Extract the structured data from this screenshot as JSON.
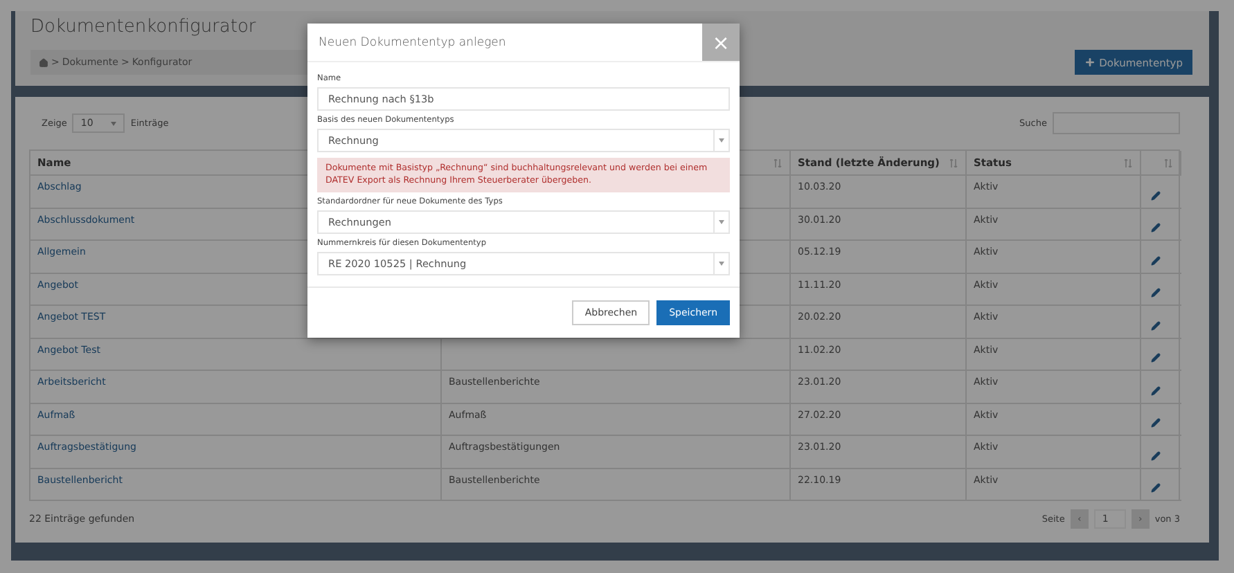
{
  "page": {
    "title": "Dokumentenkonfigurator",
    "breadcrumb": [
      {
        "separator": ">",
        "label": "Dokumente"
      },
      {
        "separator": ">",
        "label": "Konfigurator"
      }
    ],
    "add_button": "Dokumententyp"
  },
  "table_controls": {
    "show_label": "Zeige",
    "page_size": "10",
    "entries_label": "Einträge",
    "search_label": "Suche"
  },
  "table": {
    "columns": [
      {
        "label": "Name"
      },
      {},
      {
        "label": "Stand (letzte Änderung)"
      },
      {
        "label": "Status"
      },
      {}
    ],
    "rows": [
      {
        "name": "Abschlag",
        "date": "10.03.20",
        "status": "Aktiv"
      },
      {
        "name": "Abschlussdokument",
        "date": "30.01.20",
        "status": "Aktiv"
      },
      {
        "name": "Allgemein",
        "date": "05.12.19",
        "status": "Aktiv"
      },
      {
        "name": "Angebot",
        "date": "11.11.20",
        "status": "Aktiv"
      },
      {
        "name": "Angebot TEST",
        "date": "20.02.20",
        "status": "Aktiv"
      },
      {
        "name": "Angebot Test",
        "date": "11.02.20",
        "status": "Aktiv"
      },
      {
        "name": "Arbeitsbericht",
        "folder": "Baustellenberichte",
        "date": "23.01.20",
        "status": "Aktiv"
      },
      {
        "name": "Aufmaß",
        "folder": "Aufmaß",
        "date": "27.02.20",
        "status": "Aktiv"
      },
      {
        "name": "Auftragsbestätigung",
        "folder": "Auftragsbestätigungen",
        "date": "23.01.20",
        "status": "Aktiv"
      },
      {
        "name": "Baustellenbericht",
        "folder": "Baustellenberichte",
        "date": "22.10.19",
        "status": "Aktiv"
      }
    ]
  },
  "table_footer": {
    "count": "22 Einträge gefunden",
    "page_label": "Seite",
    "prev": "‹",
    "page": "1",
    "next": "›",
    "of": "von 3"
  },
  "modal": {
    "title": "Neuen Dokumententyp anlegen",
    "close": "×",
    "fields": [
      {
        "kind": "input",
        "label": "Name",
        "value": "Rechnung nach §13b"
      },
      {
        "kind": "select",
        "label": "Basis des neuen Dokumententyps",
        "value": "Rechnung"
      },
      {
        "kind": "alert",
        "text": "Dokumente mit Basistyp „Rechnung“ sind buchhaltungsrelevant und werden bei einem DATEV Export als Rechnung Ihrem Steuerberater übergeben."
      },
      {
        "kind": "select",
        "label": "Standardordner für neue Dokumente des Typs",
        "value": "Rechnungen"
      },
      {
        "kind": "select",
        "label": "Nummernkreis für diesen Dokumententyp",
        "value": "RE 2020 10525 | Rechnung"
      }
    ],
    "buttons": [
      {
        "kind": "secondary",
        "label": "Abbrechen"
      },
      {
        "kind": "primary",
        "label": "Speichern"
      }
    ]
  }
}
